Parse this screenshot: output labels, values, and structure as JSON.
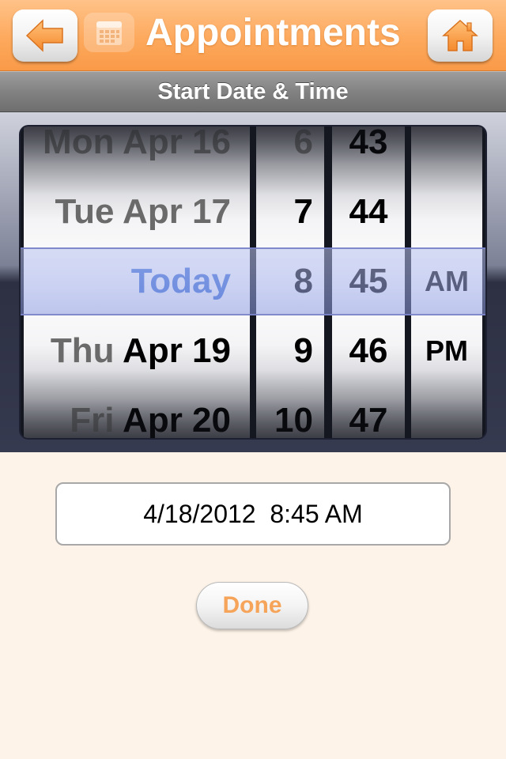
{
  "header": {
    "title": "Appointments",
    "back_icon": "arrow-left-icon",
    "calendar_icon": "calendar-icon",
    "home_icon": "home-icon",
    "accent_color": "#f99a48"
  },
  "section": {
    "title": "Start Date & Time"
  },
  "picker": {
    "dates": [
      {
        "day": "Mon",
        "date": "Apr 16"
      },
      {
        "day": "Tue",
        "date": "Apr 17"
      },
      {
        "day": "",
        "date": "Today"
      },
      {
        "day": "Thu",
        "date": "Apr 19"
      },
      {
        "day": "Fri",
        "date": "Apr 20"
      }
    ],
    "hours": [
      "6",
      "7",
      "8",
      "9",
      "10"
    ],
    "minutes": [
      "43",
      "44",
      "45",
      "46",
      "47"
    ],
    "periods": [
      "AM",
      "PM"
    ],
    "selected_date": "Today",
    "selected_hour": "8",
    "selected_minute": "45",
    "selected_period": "AM"
  },
  "result": {
    "value": "4/18/2012  8:45 AM"
  },
  "actions": {
    "done_label": "Done"
  }
}
